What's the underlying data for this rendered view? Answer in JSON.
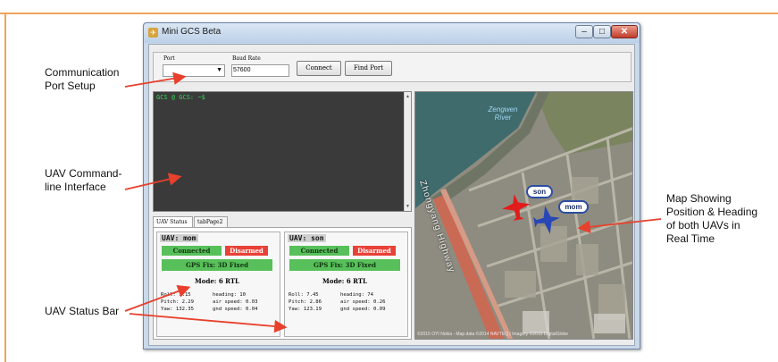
{
  "annotations": {
    "port_setup": "Communication Port Setup",
    "cli": "UAV Command-line Interface",
    "status_bar": "UAV Status Bar",
    "map": "Map Showing Position & Heading of both UAVs in Real Time"
  },
  "window": {
    "title": "Mini GCS Beta",
    "minimize_icon": "minimize-icon",
    "maximize_icon": "maximize-icon",
    "close_icon": "close-icon"
  },
  "port": {
    "port_label": "Port",
    "port_value": "",
    "baud_label": "Baud Rate",
    "baud_value": "57600",
    "connect_label": "Connect",
    "find_label": "Find Port"
  },
  "terminal": {
    "prompt": "GCS @ GCS: ~$"
  },
  "tabs": [
    {
      "label": "UAV Status",
      "active": true
    },
    {
      "label": "tabPage2",
      "active": false
    }
  ],
  "uavs": [
    {
      "title": "UAV: mom",
      "connection": "Connected",
      "arm_state": "Disarmed",
      "gps": "GPS Fix: 3D Fixed",
      "mode": "Mode: 6 RTL",
      "roll": "Roll: 1.15",
      "pitch": "Pitch: 2.29",
      "yaw": "Yaw: 132.35",
      "heading": "heading: 10",
      "air_speed": "air speed: 0.03",
      "gnd_speed": "gnd speed: 0.04"
    },
    {
      "title": "UAV: son",
      "connection": "Connected",
      "arm_state": "Disarmed",
      "gps": "GPS Fix: 3D Fixed",
      "mode": "Mode: 6 RTL",
      "roll": "Roll: 7.45",
      "pitch": "Pitch: 2.86",
      "yaw": "Yaw: 123.19",
      "heading": "heading: 74",
      "air_speed": "air speed: 0.26",
      "gnd_speed": "gnd speed: 0.09"
    }
  ],
  "map": {
    "river_label_1": "Zengwen",
    "river_label_2": "River",
    "highway_label": "Zhongyang Highway",
    "son_label": "son",
    "mom_label": "mom",
    "footer": "©2015 OYI Nokia - Map data ©2014 NAVTEQ | Imagery ©2015 DigitalGlobe"
  },
  "colors": {
    "accent_frame": "#f0a35a",
    "connected_green": "#58c05a",
    "disarmed_red": "#e84137",
    "terminal_text": "#35d65a",
    "son_plane": "#e21b1b",
    "mom_plane": "#2846b5",
    "arrow": "#e8402c"
  }
}
